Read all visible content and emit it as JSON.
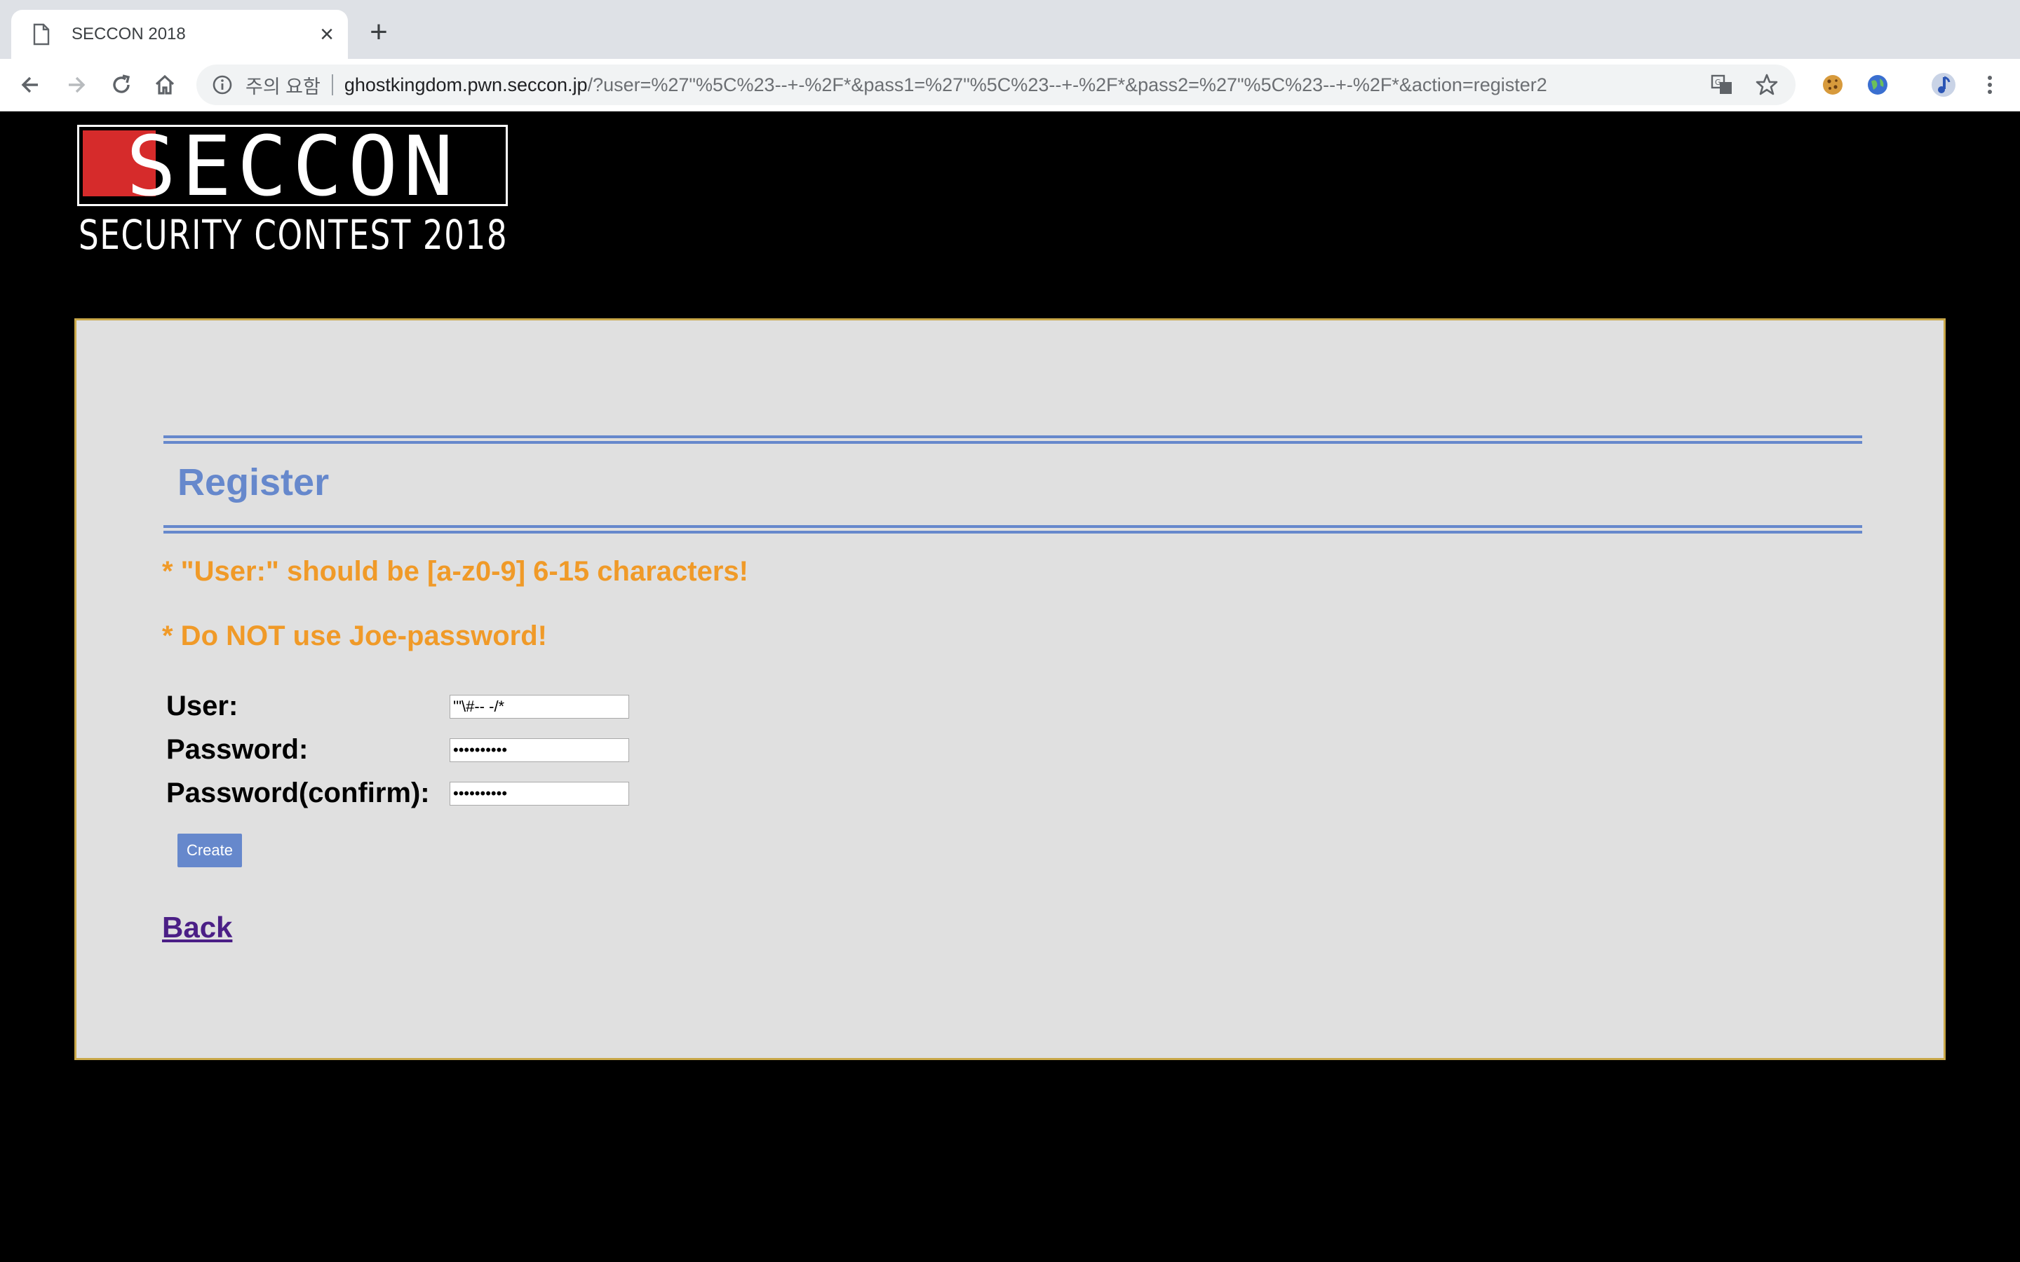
{
  "browser": {
    "tab_title": "SECCON 2018",
    "tab_close": "×",
    "new_tab": "+",
    "security_label": "주의 요함",
    "url_host": "ghostkingdom.pwn.seccon.jp",
    "url_path": "/?user=%27\"%5C%23--+-%2F*&pass1=%27\"%5C%23--+-%2F*&pass2=%27\"%5C%23--+-%2F*&action=register2"
  },
  "logo": {
    "main": "SECCON",
    "sub": "SECURITY CONTEST 2018",
    "accent_color": "#d62b2b"
  },
  "register": {
    "title": "Register",
    "notes": [
      "* \"User:\" should be [a-z0-9] 6-15 characters!",
      "* Do NOT use Joe-password!"
    ],
    "fields": {
      "user_label": "User:",
      "user_value": "'\"\\#-- -/*",
      "password_label": "Password:",
      "password_value": "••••••••••",
      "confirm_label": "Password(confirm):",
      "confirm_value": "••••••••••"
    },
    "create_label": "Create",
    "back_label": "Back"
  },
  "colors": {
    "heading": "#6688cc",
    "notice": "#f09a28",
    "panel_border": "#c9a84a",
    "link": "#4b1f86"
  }
}
